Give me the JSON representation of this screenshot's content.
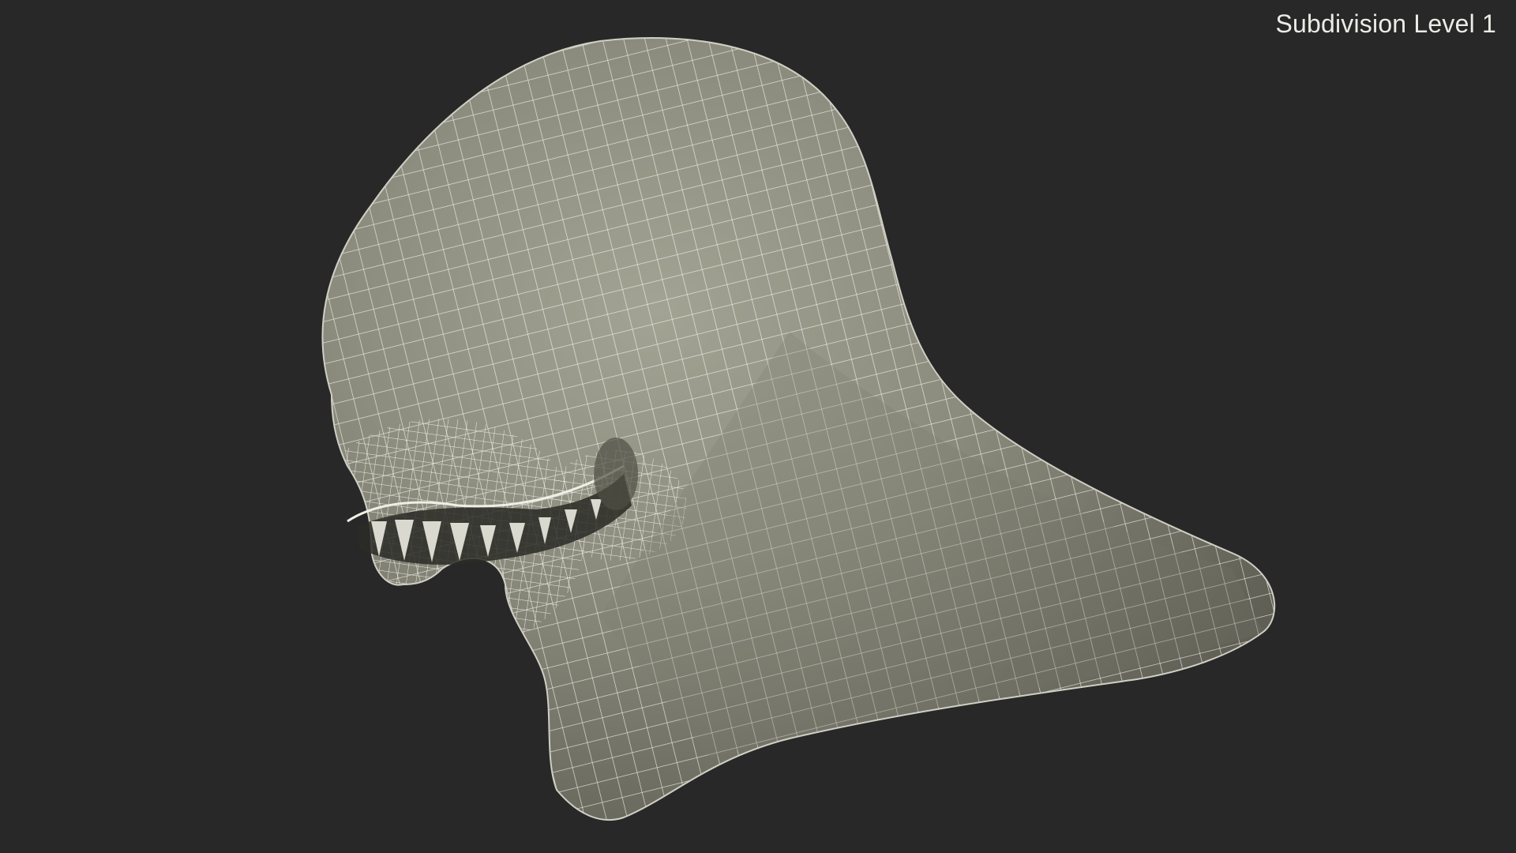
{
  "viewport": {
    "subdivision_label": "Subdivision Level 1",
    "background_color": "#282828",
    "model_color": "#8a8a7c",
    "wire_color": "#f2f2ea"
  },
  "model": {
    "name_icon": "creature-head-wireframe"
  }
}
